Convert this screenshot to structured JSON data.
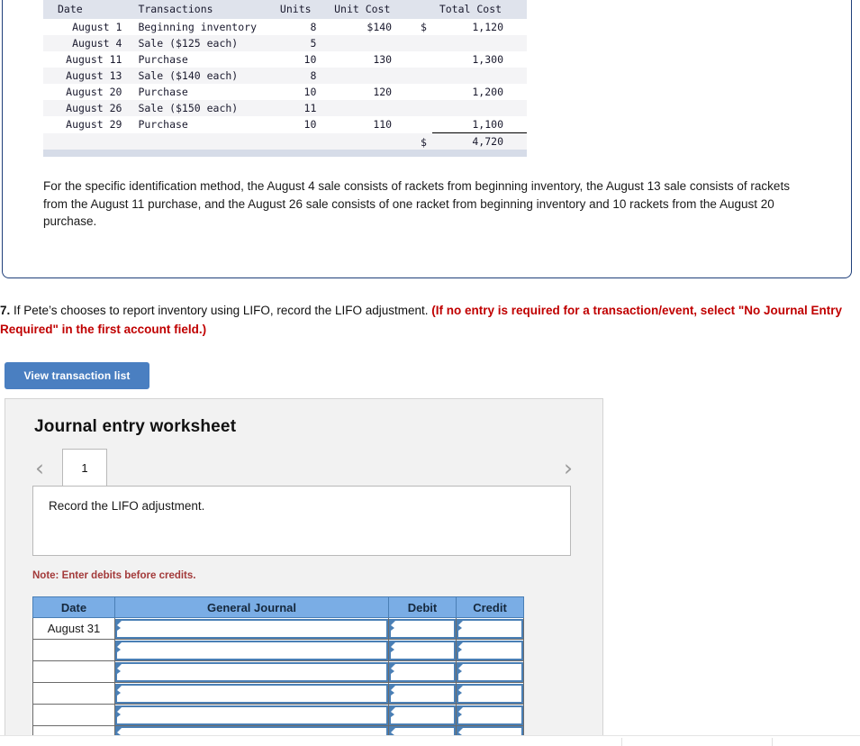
{
  "transactions_table": {
    "headers": [
      "Date",
      "Transactions",
      "Units",
      "Unit Cost",
      "Total Cost"
    ],
    "rows": [
      {
        "date": "August  1",
        "transaction": "Beginning inventory",
        "units": "8",
        "unit_cost": "$140",
        "currency": "$",
        "total_cost": "1,120"
      },
      {
        "date": "August  4",
        "transaction": "Sale ($125 each)",
        "units": "5",
        "unit_cost": "",
        "currency": "",
        "total_cost": ""
      },
      {
        "date": "August 11",
        "transaction": "Purchase",
        "units": "10",
        "unit_cost": "130",
        "currency": "",
        "total_cost": "1,300"
      },
      {
        "date": "August 13",
        "transaction": "Sale ($140 each)",
        "units": "8",
        "unit_cost": "",
        "currency": "",
        "total_cost": ""
      },
      {
        "date": "August 20",
        "transaction": "Purchase",
        "units": "10",
        "unit_cost": "120",
        "currency": "",
        "total_cost": "1,200"
      },
      {
        "date": "August 26",
        "transaction": "Sale ($150 each)",
        "units": "11",
        "unit_cost": "",
        "currency": "",
        "total_cost": ""
      },
      {
        "date": "August 29",
        "transaction": "Purchase",
        "units": "10",
        "unit_cost": "110",
        "currency": "",
        "total_cost": "1,100"
      }
    ],
    "total_row": {
      "currency": "$",
      "total_cost": "4,720"
    }
  },
  "specific_identification_note": "For the specific identification method, the August 4 sale consists of rackets from beginning inventory, the August 13 sale consists of rackets from the August 11 purchase, and the August 26 sale consists of one racket from beginning inventory and 10 rackets from the August 20 purchase.",
  "question": {
    "number": "7.",
    "text": " If Pete’s chooses to report inventory using LIFO, record the LIFO adjustment. ",
    "emphasis": "(If no entry is required for a transaction/event, select \"No Journal Entry Required\" in the first account field.)"
  },
  "view_transaction_list_label": "View transaction list",
  "worksheet": {
    "title": "Journal entry worksheet",
    "prev_icon": "‹",
    "next_icon": "›",
    "tabs": [
      "1"
    ],
    "prompt": "Record the LIFO adjustment.",
    "note": "Note: Enter debits before credits.",
    "table": {
      "headers": [
        "Date",
        "General Journal",
        "Debit",
        "Credit"
      ],
      "rows": [
        {
          "date": "August 31",
          "general_journal": "",
          "debit": "",
          "credit": ""
        },
        {
          "date": "",
          "general_journal": "",
          "debit": "",
          "credit": ""
        },
        {
          "date": "",
          "general_journal": "",
          "debit": "",
          "credit": ""
        },
        {
          "date": "",
          "general_journal": "",
          "debit": "",
          "credit": ""
        },
        {
          "date": "",
          "general_journal": "",
          "debit": "",
          "credit": ""
        },
        {
          "date": "",
          "general_journal": "",
          "debit": "",
          "credit": ""
        }
      ]
    }
  },
  "colors": {
    "panel_border": "#1f3f7a",
    "button_blue": "#4a7fc1",
    "table_header_blue": "#7aade5",
    "note_red": "#a33a3a",
    "emphasis_red": "#c00000"
  }
}
